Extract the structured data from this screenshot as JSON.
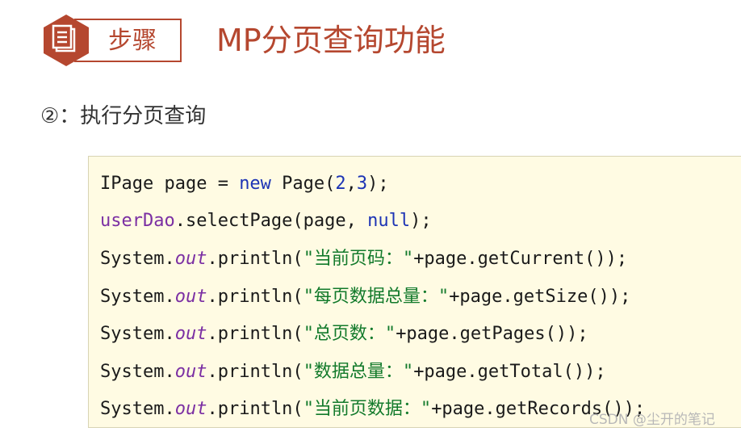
{
  "header": {
    "step_label": "步骤",
    "title": "MP分页查询功能"
  },
  "subheading": "②：执行分页查询",
  "code": {
    "line1": {
      "a": "IPage page = ",
      "kw": "new",
      "b": " Page(",
      "n1": "2",
      "c": ",",
      "n2": "3",
      "d": ");"
    },
    "line2": {
      "field": "userDao",
      "a": ".selectPage(page, ",
      "kw": "null",
      "b": ");"
    },
    "line3": {
      "a": "System.",
      "out": "out",
      "b": ".println(",
      "str": "\"当前页码：\"",
      "c": "+page.getCurrent());"
    },
    "line4": {
      "a": "System.",
      "out": "out",
      "b": ".println(",
      "str": "\"每页数据总量：\"",
      "c": "+page.getSize());"
    },
    "line5": {
      "a": "System.",
      "out": "out",
      "b": ".println(",
      "str": "\"总页数：\"",
      "c": "+page.getPages());"
    },
    "line6": {
      "a": "System.",
      "out": "out",
      "b": ".println(",
      "str": "\"数据总量：\"",
      "c": "+page.getTotal());"
    },
    "line7": {
      "a": "System.",
      "out": "out",
      "b": ".println(",
      "str": "\"当前页数据：\"",
      "c": "+page.getRecords());"
    }
  },
  "watermark": "CSDN @尘开的笔记",
  "colors": {
    "accent": "#b5472f",
    "code_bg": "#fffbe3",
    "keyword": "#1d34b5",
    "string": "#127a2b",
    "field": "#7b2fa3"
  },
  "icons": {
    "step_icon": "document-icon"
  }
}
